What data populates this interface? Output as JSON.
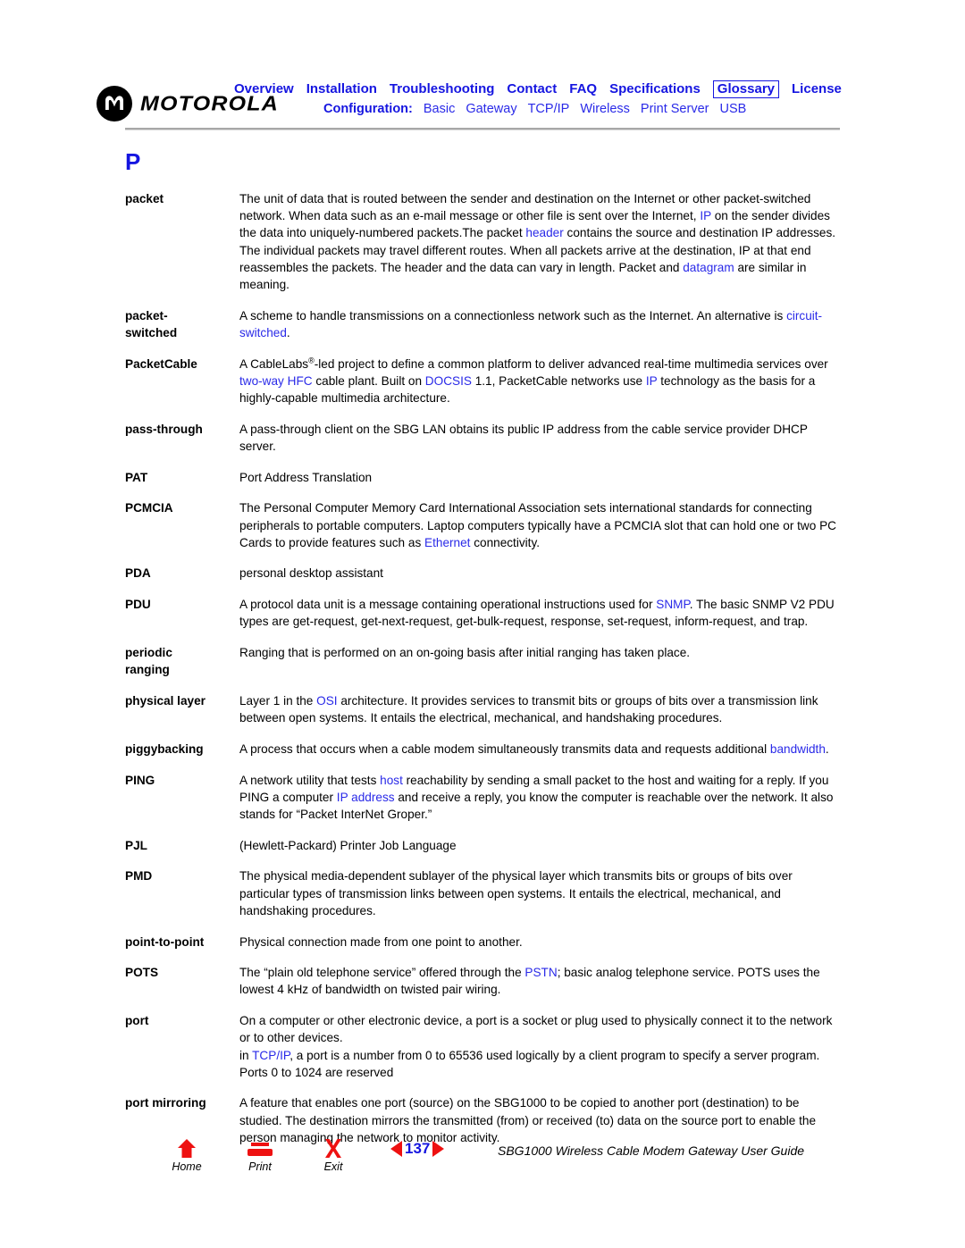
{
  "brand": {
    "name": "MOTOROLA",
    "logo_icon": "motorola-batwing-icon"
  },
  "nav": {
    "primary": [
      {
        "label": "Overview",
        "boxed": false
      },
      {
        "label": "Installation",
        "boxed": false
      },
      {
        "label": "Troubleshooting",
        "boxed": false
      },
      {
        "label": "Contact",
        "boxed": false
      },
      {
        "label": "FAQ",
        "boxed": false
      },
      {
        "label": "Specifications",
        "boxed": false
      },
      {
        "label": "Glossary",
        "boxed": true
      },
      {
        "label": "License",
        "boxed": false
      }
    ],
    "secondary_label": "Configuration:",
    "secondary": [
      {
        "label": "Basic"
      },
      {
        "label": "Gateway"
      },
      {
        "label": "TCP/IP"
      },
      {
        "label": "Wireless"
      },
      {
        "label": "Print Server"
      },
      {
        "label": "USB"
      }
    ],
    "link_color": "#1515E0"
  },
  "page": {
    "section_letter": "P"
  },
  "glossary": {
    "entries": [
      {
        "term": "packet",
        "definition": "The unit of data that is routed between the sender and destination on the Internet or other packet-switched network. When data such as an e-mail message or other file is sent over the Internet, IP on the sender divides the data into uniquely-numbered packets.The packet header contains the source and destination IP addresses. The individual packets may travel different routes. When all packets arrive at the destination, IP at that end reassembles the packets. The header and the data can vary in length. Packet and datagram are similar in meaning.",
        "links": [
          "IP",
          "header",
          "datagram"
        ]
      },
      {
        "term": "packet-switched",
        "definition": "A scheme to handle transmissions on a connectionless network such as the Internet. An alternative is circuit-switched.",
        "links": [
          "circuit-switched"
        ]
      },
      {
        "term": "PacketCable",
        "definition": "A CableLabs®-led project to define a common platform to deliver advanced real-time multimedia services over two-way HFC cable plant. Built on DOCSIS 1.1, PacketCable networks use IP technology as the basis for a highly-capable multimedia architecture.",
        "links": [
          "two-way",
          "HFC",
          "DOCSIS",
          "IP"
        ]
      },
      {
        "term": "pass-through",
        "definition": "A pass-through client on the SBG LAN obtains its public IP address from the cable service provider DHCP server.",
        "links": []
      },
      {
        "term": "PAT",
        "definition": "Port Address Translation",
        "links": []
      },
      {
        "term": "PCMCIA",
        "definition": "The Personal Computer Memory Card International Association sets international standards for connecting peripherals to portable computers. Laptop computers typically have a PCMCIA slot that can hold one or two PC Cards to provide features such as Ethernet connectivity.",
        "links": [
          "Ethernet"
        ]
      },
      {
        "term": "PDA",
        "definition": "personal desktop assistant",
        "links": []
      },
      {
        "term": "PDU",
        "definition": "A protocol data unit is a message containing operational instructions used for SNMP. The basic SNMP V2 PDU types are get-request, get-next-request, get-bulk-request, response, set-request, inform-request, and trap.",
        "links": [
          "SNMP"
        ]
      },
      {
        "term": "periodic ranging",
        "definition": "Ranging that is performed on an on-going basis after initial ranging has taken place.",
        "links": []
      },
      {
        "term": "physical layer",
        "definition": "Layer 1 in the OSI architecture. It provides services to transmit bits or groups of bits over a transmission link between open systems. It entails the electrical, mechanical, and handshaking procedures.",
        "links": [
          "OSI"
        ]
      },
      {
        "term": "piggybacking",
        "definition": "A process that occurs when a cable modem simultaneously transmits data and requests additional bandwidth.",
        "links": [
          "bandwidth"
        ]
      },
      {
        "term": "PING",
        "definition": "A network utility that tests host reachability by sending a small packet to the host and waiting for a reply. If you PING a computer IP address and receive a reply, you know the computer is reachable over the network. It also stands for “Packet InterNet Groper.”",
        "links": [
          "host",
          "IP address"
        ]
      },
      {
        "term": "PJL",
        "definition": "(Hewlett-Packard) Printer Job Language",
        "links": []
      },
      {
        "term": "PMD",
        "definition": "The physical media-dependent sublayer of the physical layer which transmits bits or groups of bits over particular types of transmission links between open systems. It entails the electrical, mechanical, and handshaking procedures.",
        "links": []
      },
      {
        "term": "point-to-point",
        "definition": "Physical connection made from one point to another.",
        "links": []
      },
      {
        "term": "POTS",
        "definition": "The “plain old telephone service” offered through the PSTN; basic analog telephone service. POTS uses the lowest 4 kHz of bandwidth on twisted pair wiring.",
        "links": [
          "PSTN"
        ]
      },
      {
        "term": "port",
        "definition": "On a computer or other electronic device, a port is a socket or plug used to physically connect it to the network or to other devices.",
        "definition2": "in TCP/IP, a port is a number from 0 to 65536 used logically by a client program to specify a server program. Ports 0 to 1024 are reserved",
        "links": [
          "TCP/IP"
        ]
      },
      {
        "term": "port mirroring",
        "definition": "A feature that enables one port (source) on the SBG1000 to be copied to another port (destination) to be studied. The destination mirrors the transmitted (from) or received (to) data on the source port to enable the person managing the network to monitor activity.",
        "links": []
      }
    ]
  },
  "footer": {
    "buttons": [
      {
        "label": "Home",
        "icon": "home-icon"
      },
      {
        "label": "Print",
        "icon": "printer-icon"
      },
      {
        "label": "Exit",
        "icon": "close-x-icon"
      }
    ],
    "page_number": "137",
    "prev_icon": "triangle-left-icon",
    "next_icon": "triangle-right-icon",
    "doc_title": "SBG1000 Wireless Cable Modem Gateway User Guide",
    "accent_red": "#EE1111",
    "accent_blue": "#1515E0"
  }
}
